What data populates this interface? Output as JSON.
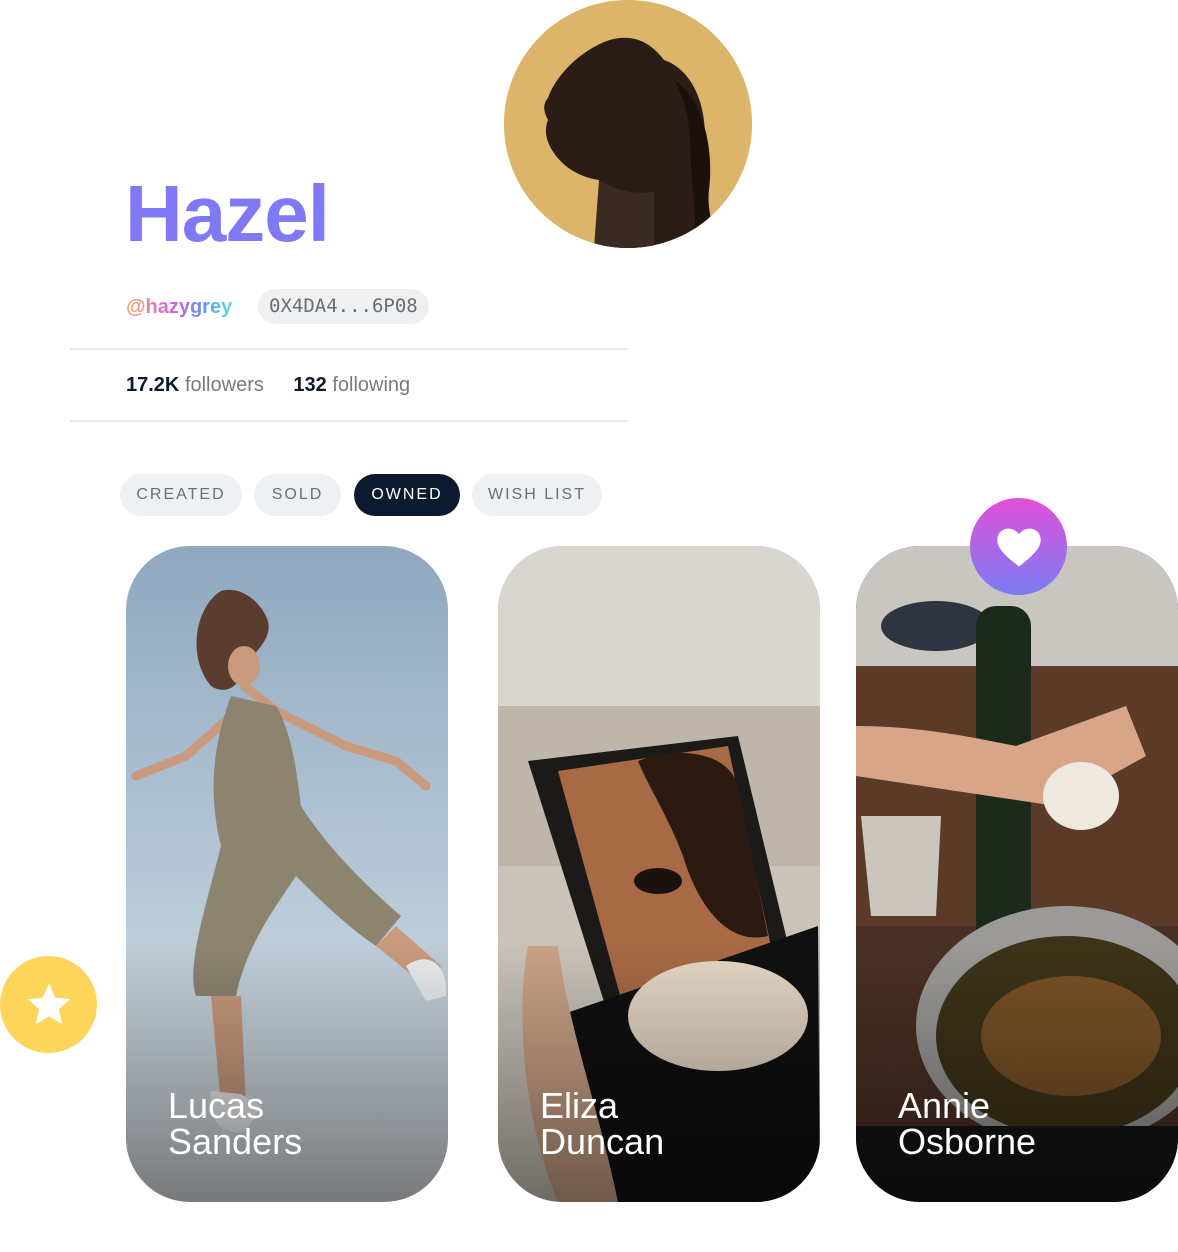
{
  "profile": {
    "name": "Hazel",
    "handle": "@hazygrey",
    "wallet": "0X4DA4...6P08",
    "followers_count": "17.2K",
    "followers_label": "followers",
    "following_count": "132",
    "following_label": "following"
  },
  "tabs": [
    {
      "label": "CREATED",
      "active": false
    },
    {
      "label": "SOLD",
      "active": false
    },
    {
      "label": "OWNED",
      "active": true
    },
    {
      "label": "WISH LIST",
      "active": false
    }
  ],
  "cards": [
    {
      "line1": "Lucas",
      "line2": "Sanders"
    },
    {
      "line1": "Eliza",
      "line2": "Duncan"
    },
    {
      "line1": "Annie",
      "line2": "Osborne"
    }
  ],
  "icons": {
    "favorite_badge": "heart-icon",
    "featured_badge": "star-icon"
  },
  "colors": {
    "name": "#8079f5",
    "active_tab": "#0b1a2e",
    "heart_badge_top": "#e24fd8",
    "heart_badge_bottom": "#7a7cf3",
    "star_badge": "#fdd55a"
  }
}
